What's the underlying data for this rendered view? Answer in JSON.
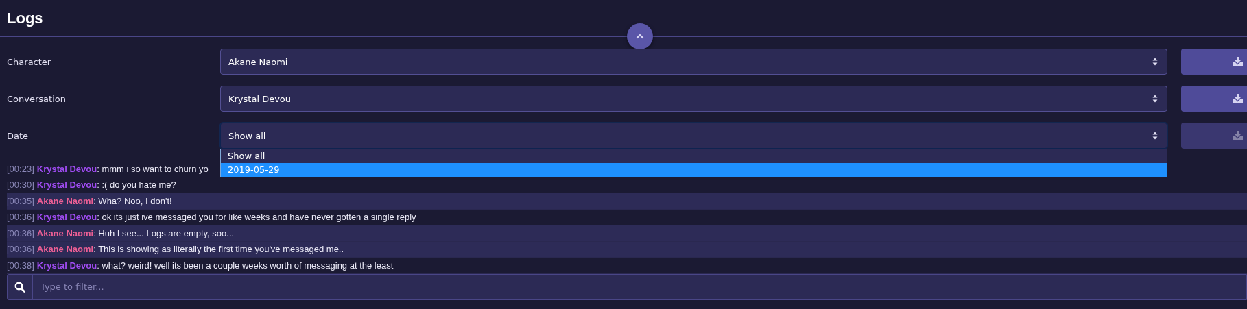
{
  "title": "Logs",
  "collapse_toggle": {
    "expanded": true
  },
  "filters": [
    {
      "label": "Character",
      "value": "Akane Naomi",
      "focused": false,
      "download_disabled": false
    },
    {
      "label": "Conversation",
      "value": "Krystal Devou",
      "focused": false,
      "download_disabled": false
    },
    {
      "label": "Date",
      "value": "Show all",
      "focused": true,
      "download_disabled": true
    }
  ],
  "date_dropdown": {
    "options": [
      {
        "label": "Show all",
        "selected": false
      },
      {
        "label": "2019-05-29",
        "selected": true
      }
    ]
  },
  "messages": [
    {
      "time": "[00:23]",
      "speaker": "Krystal Devou",
      "color": "#a04cf2",
      "text": ": mmm i so want to churn yo",
      "highlighted": false
    },
    {
      "time": "[00:30]",
      "speaker": "Krystal Devou",
      "color": "#a04cf2",
      "text": ": :( do you hate me?",
      "highlighted": false
    },
    {
      "time": "[00:35]",
      "speaker": "Akane Naomi",
      "color": "#ee5f95",
      "text": ": Wha? Noo, I don't!",
      "highlighted": true
    },
    {
      "time": "[00:36]",
      "speaker": "Krystal Devou",
      "color": "#a04cf2",
      "text": ": ok its just ive messaged you for like weeks and have never gotten a single reply",
      "highlighted": false
    },
    {
      "time": "[00:36]",
      "speaker": "Akane Naomi",
      "color": "#ee5f95",
      "text": ": Huh I see... Logs are empty, soo...",
      "highlighted": true
    },
    {
      "time": "[00:36]",
      "speaker": "Akane Naomi",
      "color": "#ee5f95",
      "text": ": This is showing as literally the first time you've messaged me..",
      "highlighted": true
    },
    {
      "time": "[00:38]",
      "speaker": "Krystal Devou",
      "color": "#a04cf2",
      "text": ": what? weird! well its been a couple weeks worth of messaging at the least",
      "highlighted": false
    }
  ],
  "filter_field": {
    "placeholder": "Type to filter..."
  }
}
